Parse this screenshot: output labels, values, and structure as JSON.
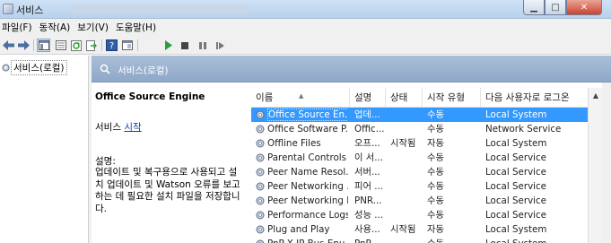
{
  "window": {
    "title": "서비스",
    "buttons": {
      "minimize": "▁",
      "maximize": "□",
      "close": "✕"
    }
  },
  "menu": [
    "파일(F)",
    "동작(A)",
    "보기(V)",
    "도움말(H)"
  ],
  "toolbar": {
    "icons": [
      "back-arrow-icon",
      "forward-arrow-icon",
      "console-tree-icon",
      "properties-list-icon",
      "refresh-icon",
      "export-icon",
      "help-icon",
      "show-hide-pane-icon",
      "play-icon",
      "stop-icon",
      "pause-icon",
      "restart-icon"
    ]
  },
  "tree": {
    "root_label": "서비스(로컬)"
  },
  "header": {
    "label": "서비스(로컬)"
  },
  "detail": {
    "service_name": "Office  Source Engine",
    "start_prefix": "서비스 ",
    "start_link": "시작",
    "description_label": "설명:",
    "description_lines": [
      "업데이트 및 복구용으로 사용되고 설",
      "치 업데이트 및 Watson 오류를 보고",
      "하는 데 필요한 설치 파일을 저장합니",
      "다."
    ]
  },
  "list": {
    "columns": [
      "이름",
      "설명",
      "상태",
      "시작 유형",
      "다음 사용자로 로그온"
    ],
    "rows": [
      {
        "name": "Office  Source En...",
        "desc": "업데...",
        "status": "",
        "startup": "수동",
        "logon": "Local System",
        "selected": true
      },
      {
        "name": "Office Software P...",
        "desc": "Offic...",
        "status": "",
        "startup": "수동",
        "logon": "Network Service"
      },
      {
        "name": "Offline Files",
        "desc": "오프...",
        "status": "시작됨",
        "startup": "자동",
        "logon": "Local System"
      },
      {
        "name": "Parental Controls",
        "desc": "이 서...",
        "status": "",
        "startup": "수동",
        "logon": "Local Service"
      },
      {
        "name": "Peer Name Resol...",
        "desc": "서버...",
        "status": "",
        "startup": "수동",
        "logon": "Local Service"
      },
      {
        "name": "Peer Networking ...",
        "desc": "피어 ...",
        "status": "",
        "startup": "수동",
        "logon": "Local Service"
      },
      {
        "name": "Peer Networking I...",
        "desc": "PNR...",
        "status": "",
        "startup": "수동",
        "logon": "Local Service"
      },
      {
        "name": "Performance Logs...",
        "desc": "성능 ...",
        "status": "",
        "startup": "수동",
        "logon": "Local Service"
      },
      {
        "name": "Plug and Play",
        "desc": "사용...",
        "status": "시작됨",
        "startup": "자동",
        "logon": "Local System"
      },
      {
        "name": "PnP-X IP Bus Enu...",
        "desc": "PnP...",
        "status": "",
        "startup": "수동",
        "logon": "Local System"
      }
    ]
  },
  "colors": {
    "selection": "#3399ff",
    "header_band": "#9fb6d3",
    "link": "#0645ad"
  }
}
